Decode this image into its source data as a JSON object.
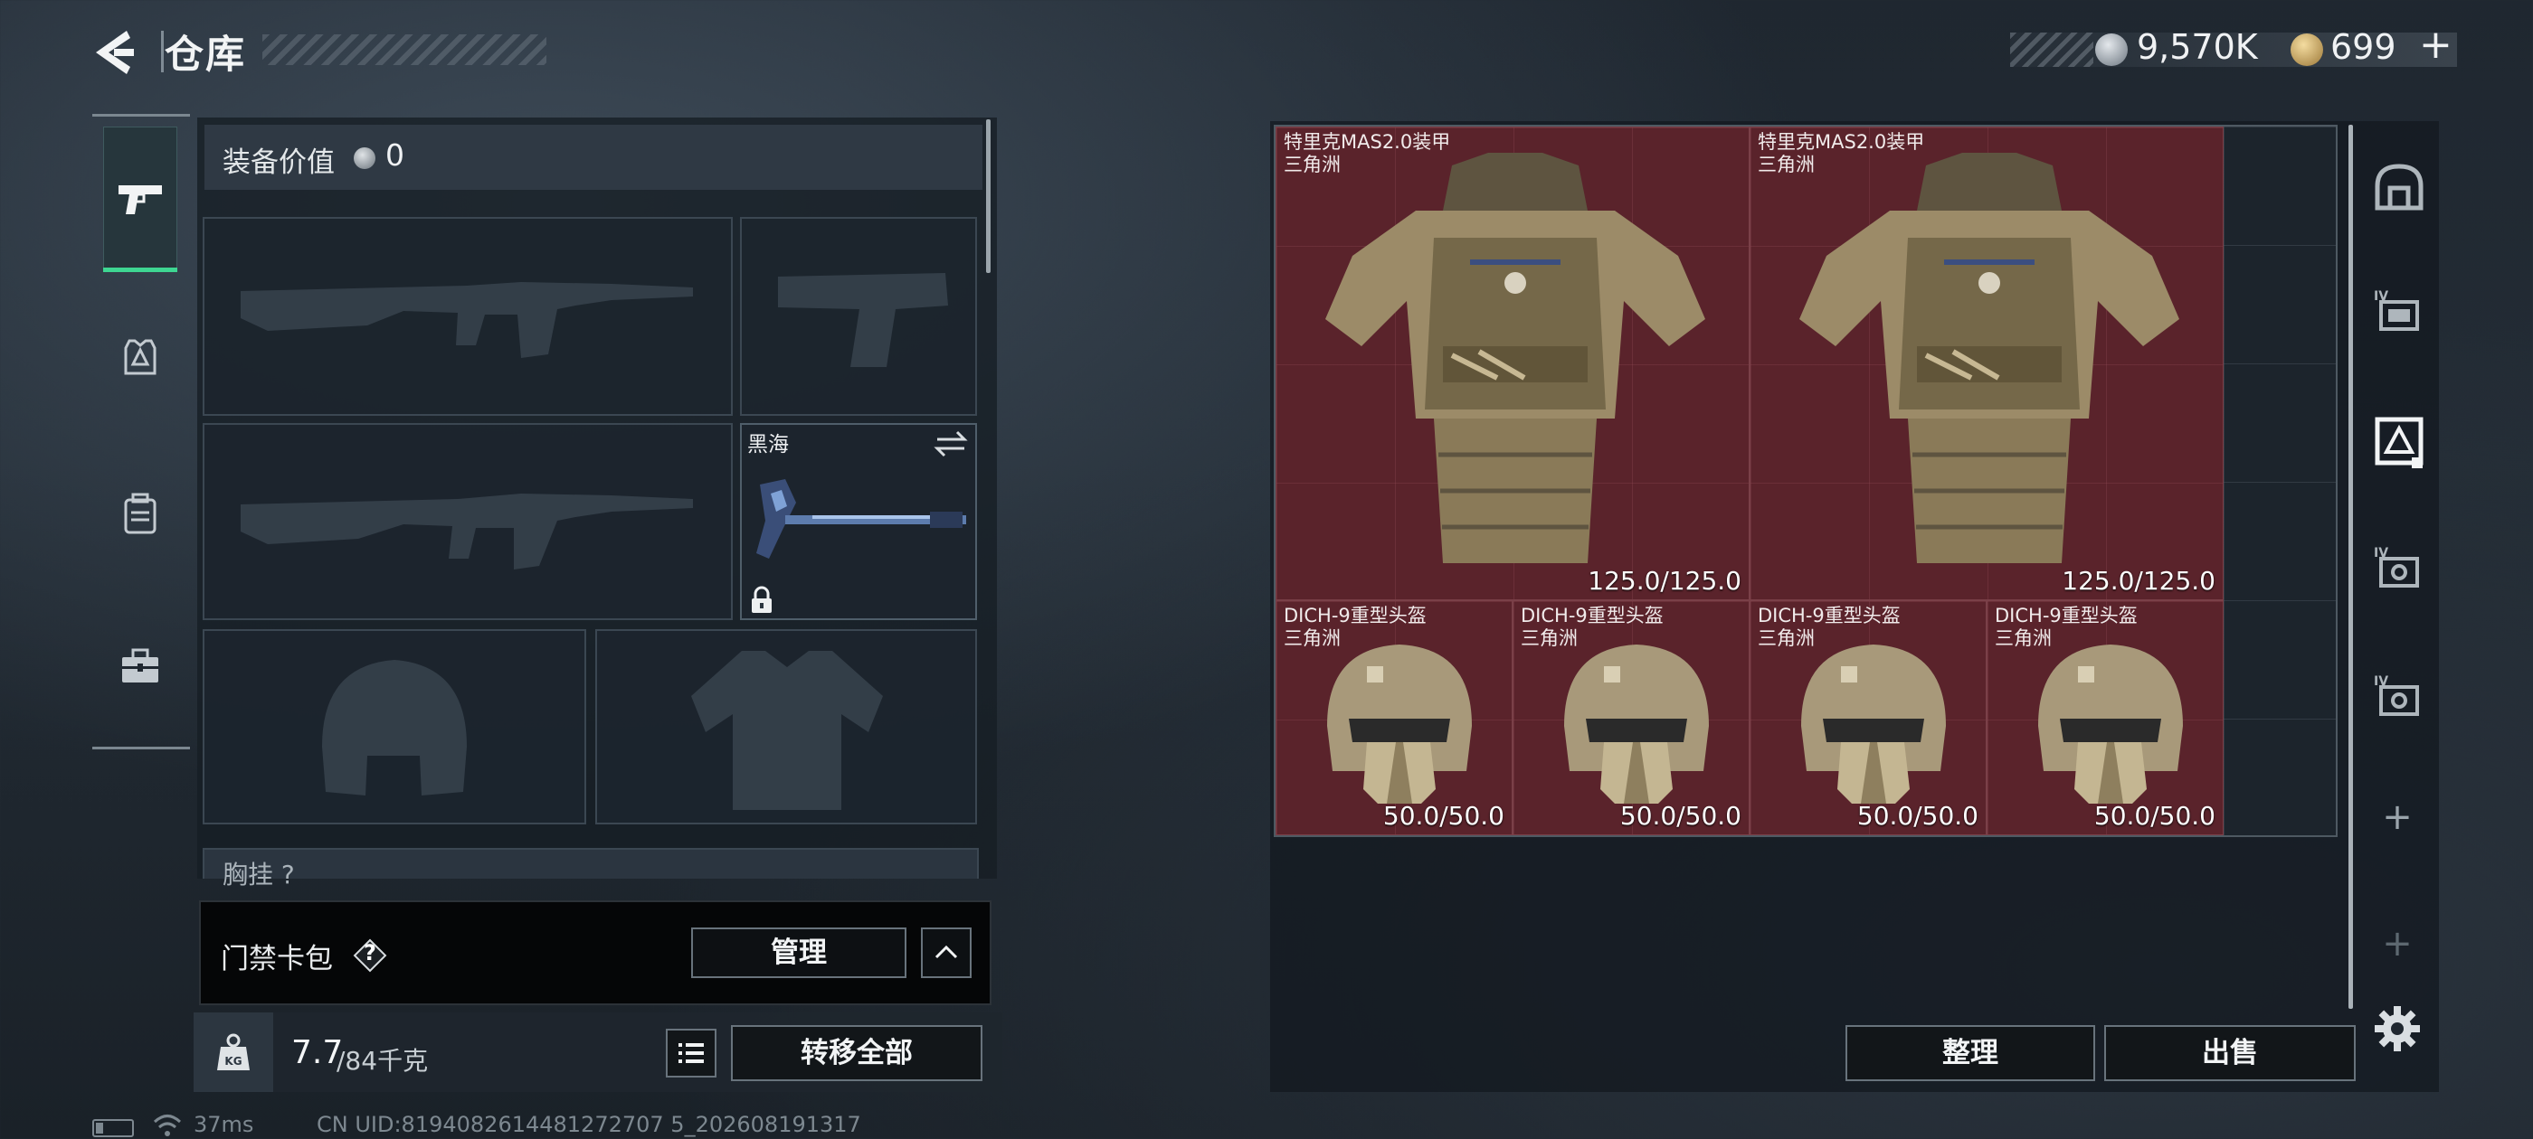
{
  "header": {
    "title": "仓库",
    "currency": {
      "silver": "9,570K",
      "gold": "699",
      "gold_add": "+"
    }
  },
  "equipment": {
    "value_label": "装备价值",
    "value": "0",
    "melee_name": "黑海",
    "chest_label": "胸挂 ?"
  },
  "keycard": {
    "label": "门禁卡包",
    "help": "?",
    "manage_label": "管理"
  },
  "weight": {
    "current": "7.7",
    "max": "/84千克"
  },
  "actions": {
    "transfer_all": "转移全部",
    "sort": "整理",
    "sell": "出售"
  },
  "stash": {
    "items": [
      {
        "name": "特里克MAS2.0装甲",
        "tag": "三角洲",
        "durability": "125.0/125.0"
      },
      {
        "name": "特里克MAS2.0装甲",
        "tag": "三角洲",
        "durability": "125.0/125.0"
      },
      {
        "name": "DICH-9重型头盔",
        "tag": "三角洲",
        "durability": "50.0/50.0"
      },
      {
        "name": "DICH-9重型头盔",
        "tag": "三角洲",
        "durability": "50.0/50.0"
      },
      {
        "name": "DICH-9重型头盔",
        "tag": "三角洲",
        "durability": "50.0/50.0"
      },
      {
        "name": "DICH-9重型头盔",
        "tag": "三角洲",
        "durability": "50.0/50.0"
      }
    ]
  },
  "containers": {
    "add_1": "+",
    "add_2": "+"
  },
  "status": {
    "ping": "37ms",
    "uid": "CN UID:8194082614481272707 5_202608191317"
  },
  "icons": {
    "back": "back-arrow-icon",
    "silver": "silver-coin-icon",
    "gold": "gold-coin-icon",
    "weapons": "pistol-icon",
    "armor": "armor-icon",
    "backpack": "backpack-icon",
    "toolbox": "toolbox-icon",
    "settings": "gear-icon"
  },
  "colors": {
    "accent": "#3ed692",
    "item_bg": "#5a232b",
    "button_border": "#68737c"
  }
}
